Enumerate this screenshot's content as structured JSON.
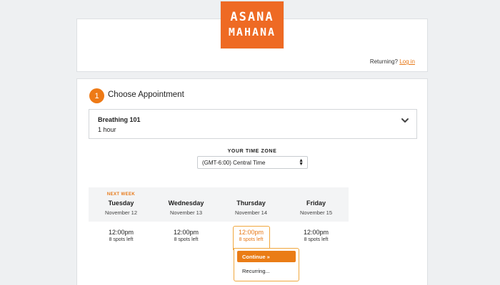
{
  "logo": {
    "line1": "ASANA",
    "line2": "MAHANA"
  },
  "header": {
    "returning_text": "Returning?",
    "login_label": "Log in"
  },
  "step": {
    "number": "1",
    "title": "Choose Appointment"
  },
  "service": {
    "name": "Breathing 101",
    "duration": "1 hour"
  },
  "timezone": {
    "label": "YOUR TIME ZONE",
    "selected": "(GMT-6:00) Central Time"
  },
  "calendar": {
    "next_week_label": "NEXT WEEK",
    "days": [
      {
        "name": "Tuesday",
        "date": "November 12"
      },
      {
        "name": "Wednesday",
        "date": "November 13"
      },
      {
        "name": "Thursday",
        "date": "November 14"
      },
      {
        "name": "Friday",
        "date": "November 15"
      }
    ],
    "slots": [
      {
        "time": "12:00pm",
        "spots": "8 spots left"
      },
      {
        "time": "12:00pm",
        "spots": "8 spots left"
      },
      {
        "time": "12:00pm",
        "spots": "8 spots left"
      },
      {
        "time": "12:00pm",
        "spots": "8 spots left"
      }
    ]
  },
  "popover": {
    "continue_label": "Continue »",
    "recurring_label": "Recurring..."
  },
  "colors": {
    "accent": "#ee7a16",
    "logo_bg": "#ee6a24",
    "page_bg": "#eef0f2"
  }
}
